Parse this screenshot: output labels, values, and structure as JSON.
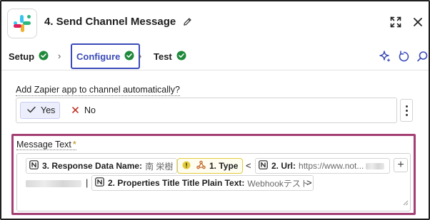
{
  "header": {
    "app_icon": "slack-logo",
    "title": "4. Send Channel Message",
    "icons": [
      "pencil-icon",
      "expand-icon",
      "close-icon"
    ]
  },
  "tabs": [
    {
      "label": "Setup",
      "status": "complete"
    },
    {
      "label": "Configure",
      "status": "complete",
      "active": true
    },
    {
      "label": "Test",
      "status": "complete"
    }
  ],
  "toolbar_icons": [
    "sparkle-icon",
    "refresh-icon",
    "search-icon"
  ],
  "colors": {
    "accent": "#3a4bb8",
    "success": "#1f8a3b",
    "highlight_border": "#a33f73",
    "required": "#b8860b"
  },
  "field_auto_add": {
    "label": "Add Zapier app to channel automatically?",
    "options": [
      {
        "label": "Yes",
        "selected": true
      },
      {
        "label": "No",
        "selected": false
      }
    ]
  },
  "field_message": {
    "label": "Message Text",
    "required_marker": "*",
    "tokens": [
      {
        "app": "notion",
        "name": "3. Response Data Name:",
        "value": "南 栄樹"
      },
      {
        "app": "webhook",
        "name": "1. Type",
        "warning": true
      },
      {
        "text": "<"
      },
      {
        "app": "notion",
        "name": "2. Url:",
        "value": "https://www.not..."
      },
      {
        "text": "|"
      },
      {
        "app": "notion",
        "name": "2. Properties Title Title Plain Text:",
        "value": "Webhookテスト"
      },
      {
        "text": ">"
      }
    ]
  }
}
